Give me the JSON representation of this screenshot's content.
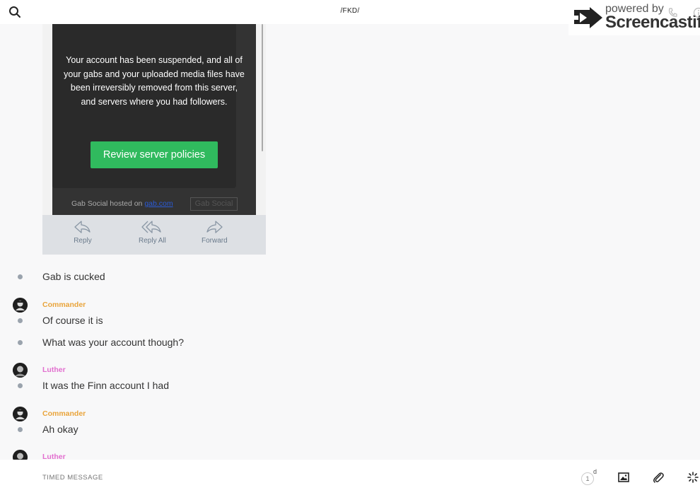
{
  "header": {
    "room_title": "/FKD/"
  },
  "watermark": {
    "powered_by": "powered by",
    "brand": "Screencastify"
  },
  "screenshot": {
    "suspension_message": "Your account has been suspended, and all of your gabs and your uploaded media files have been irreversibly removed from this server, and servers where you had followers.",
    "review_button": "Review server policies",
    "hosted_prefix": "Gab Social hosted on ",
    "hosted_link": "gab.com",
    "brand_box": "Gab Social",
    "actions": {
      "reply": "Reply",
      "reply_all": "Reply All",
      "forward": "Forward"
    }
  },
  "messages": [
    {
      "text": "Gab is cucked"
    },
    {
      "author": "Commander",
      "text": "Of course it is"
    },
    {
      "text": "What was your account though?"
    },
    {
      "author": "Luther",
      "text": "It was the Finn account I had"
    },
    {
      "author": "Commander",
      "text": "Ah okay"
    },
    {
      "author": "Luther"
    }
  ],
  "composer": {
    "placeholder": "TIMED MESSAGE",
    "timer_value": "1",
    "timer_unit": "d"
  },
  "colors": {
    "commander": "#e9a43b",
    "luther": "#e26fcf",
    "review_button": "#30ba5e"
  },
  "icons": [
    "search-icon",
    "phone-icon",
    "info-icon",
    "reply-icon",
    "reply-all-icon",
    "forward-icon",
    "image-icon",
    "attachment-icon",
    "sparkle-icon"
  ]
}
